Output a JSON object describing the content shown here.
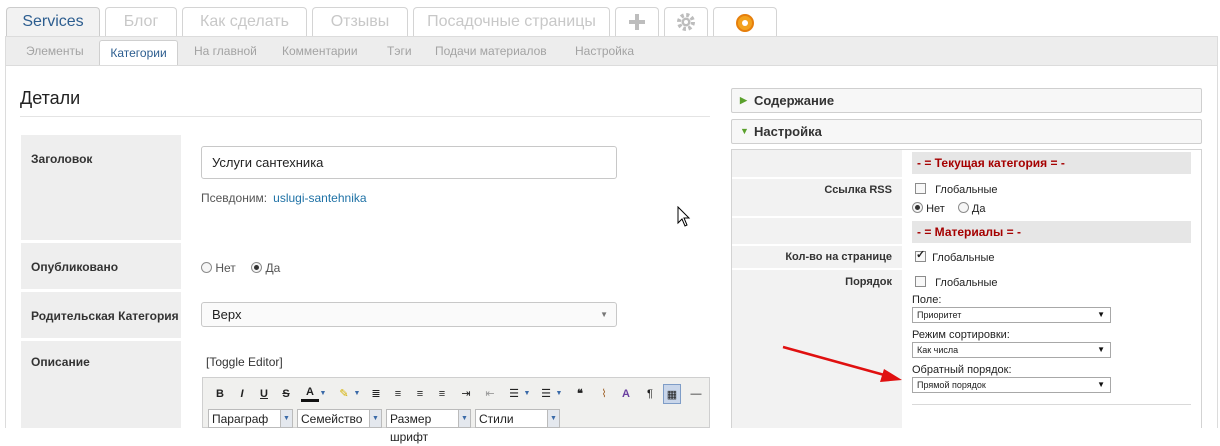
{
  "top_tabs": {
    "services": "Services",
    "blog": "Блог",
    "howto": "Как сделать",
    "reviews": "Отзывы",
    "landing": "Посадочные страницы",
    "add_icon": "plus-icon",
    "settings_icon": "gear-icon",
    "special_icon": "orange-gear-icon"
  },
  "sub_tabs": [
    "Элементы",
    "Категории",
    "На главной",
    "Комментарии",
    "Тэги",
    "Подачи материалов",
    "Настройка"
  ],
  "details": {
    "title": "Детали",
    "heading_label": "Заголовок",
    "heading_value": "Услуги сантехника",
    "alias_label": "Псевдоним:",
    "alias_value": "uslugi-santehnika",
    "published_label": "Опубликовано",
    "published_no": "Нет",
    "published_yes": "Да",
    "parent_label": "Родительская Категория",
    "parent_value": "Верх",
    "description_label": "Описание",
    "toggle_editor": "[Toggle Editor]",
    "editor_dropdowns": [
      "Параграф",
      "Семейство",
      "Размер шрифт",
      "Стили"
    ]
  },
  "right": {
    "content_header": "Содержание",
    "settings_header": "Настройка",
    "current_category": "- = Текущая категория = -",
    "rss_label": "Ссылка RSS",
    "global": "Глобальные",
    "no": "Нет",
    "yes": "Да",
    "materials": "- = Материалы = -",
    "per_page_label": "Кол-во на странице",
    "order_label": "Порядок",
    "field_label": "Поле:",
    "field_value": "Приоритет",
    "sort_mode_label": "Режим сортировки:",
    "sort_mode_value": "Как числа",
    "reverse_label": "Обратный порядок:",
    "reverse_value": "Прямой порядок"
  },
  "colors": {
    "accent": "#2c5d8f",
    "section_red": "#a50000",
    "arrow_red": "#e01010"
  }
}
